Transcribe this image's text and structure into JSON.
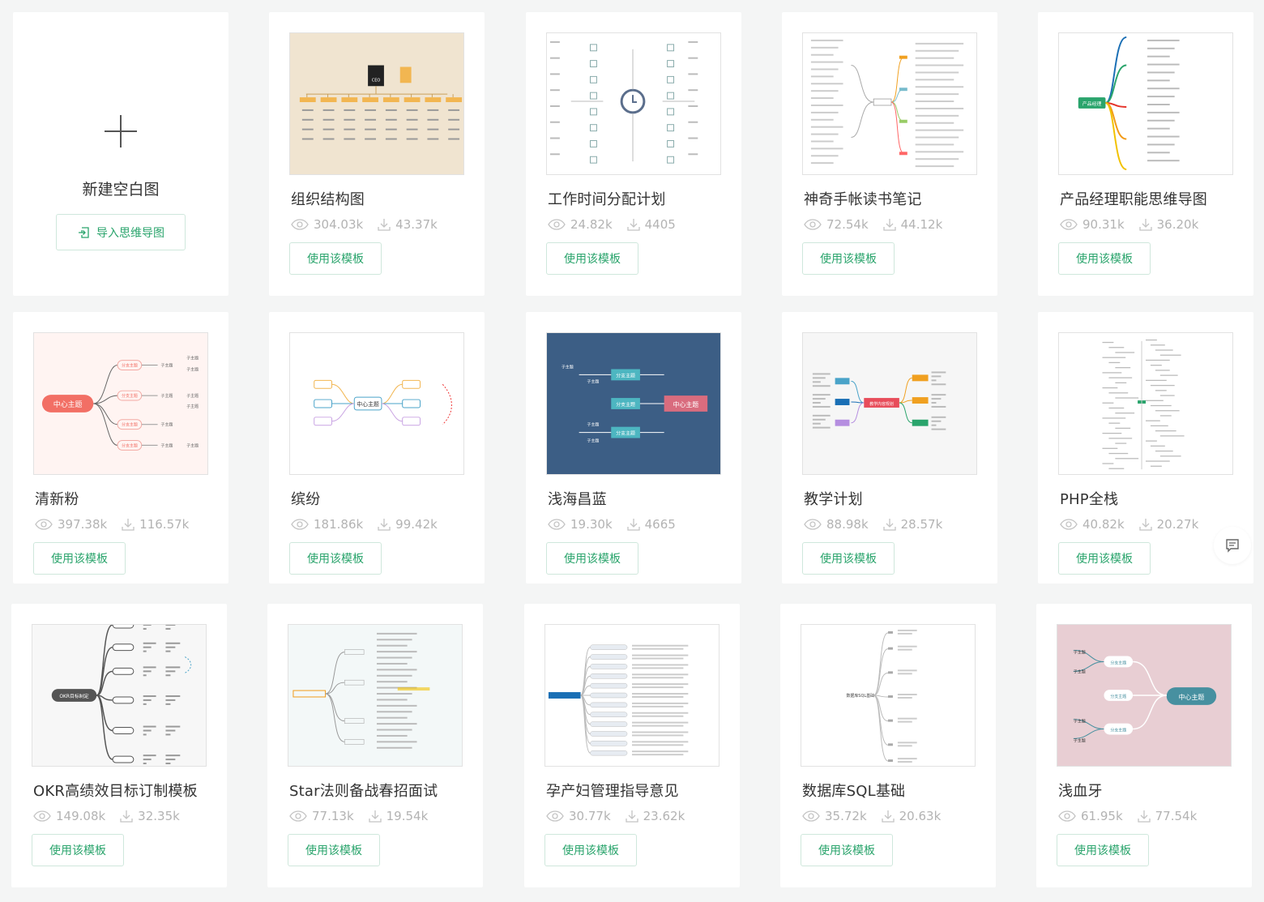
{
  "new_card": {
    "label": "新建空白图",
    "import_label": "导入思维导图"
  },
  "use_label": "使用该模板",
  "templates": [
    {
      "title": "组织结构图",
      "views": "304.03k",
      "downloads": "43.37k",
      "style": "org",
      "bg": "#f0e4d0"
    },
    {
      "title": "工作时间分配计划",
      "views": "24.82k",
      "downloads": "4405",
      "style": "clock",
      "bg": "#ffffff"
    },
    {
      "title": "神奇手帐读书笔记",
      "views": "72.54k",
      "downloads": "44.12k",
      "style": "tree",
      "bg": "#ffffff"
    },
    {
      "title": "产品经理职能思维导图",
      "views": "90.31k",
      "downloads": "36.20k",
      "style": "pm",
      "bg": "#ffffff"
    },
    {
      "title": "清新粉",
      "views": "397.38k",
      "downloads": "116.57k",
      "style": "pink",
      "bg": "#fff4f2"
    },
    {
      "title": "缤纷",
      "views": "181.86k",
      "downloads": "99.42k",
      "style": "colorful",
      "bg": "#ffffff"
    },
    {
      "title": "浅海昌蓝",
      "views": "19.30k",
      "downloads": "4665",
      "style": "navy",
      "bg": "#3c5e85"
    },
    {
      "title": "教学计划",
      "views": "88.98k",
      "downloads": "28.57k",
      "style": "teach",
      "bg": "#f6f6f6"
    },
    {
      "title": "PHP全栈",
      "views": "40.82k",
      "downloads": "20.27k",
      "style": "php",
      "bg": "#ffffff"
    },
    {
      "title": "OKR高绩效目标订制模板",
      "views": "149.08k",
      "downloads": "32.35k",
      "style": "okr",
      "bg": "#f7f7f7"
    },
    {
      "title": "Star法则备战春招面试",
      "views": "77.13k",
      "downloads": "19.54k",
      "style": "star",
      "bg": "#f3f8f8"
    },
    {
      "title": "孕产妇管理指导意见",
      "views": "30.77k",
      "downloads": "23.62k",
      "style": "maternal",
      "bg": "#ffffff"
    },
    {
      "title": "数据库SQL基础",
      "views": "35.72k",
      "downloads": "20.63k",
      "style": "sql",
      "bg": "#ffffff"
    },
    {
      "title": "浅血牙",
      "views": "61.95k",
      "downloads": "77.54k",
      "style": "rose",
      "bg": "#e8ced3"
    }
  ],
  "thumb_text": {
    "org_ceo": "CEO",
    "center_topic": "中心主题",
    "branch_topic": "分支主题",
    "sub_topic": "子主题",
    "pm_root": "产品经理",
    "teach_root": "教学内容规划",
    "okr_root": "OKR目标制定",
    "sql_root": "数据库SQL基础"
  },
  "colors": {
    "accent": "#2aa46c",
    "muted": "#b3b3b3"
  }
}
